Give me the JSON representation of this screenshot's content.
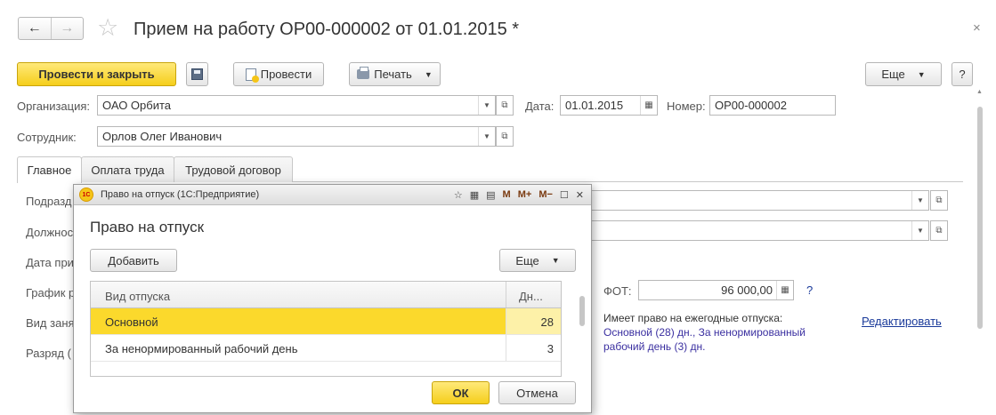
{
  "header": {
    "back_label": "←",
    "forward_label": "→",
    "star_glyph": "☆",
    "title": "Прием на работу ОР00-000002 от 01.01.2015 *",
    "close_glyph": "×"
  },
  "toolbar": {
    "post_close_label": "Провести и закрыть",
    "post_label": "Провести",
    "print_label": "Печать",
    "more_label": "Еще",
    "help_label": "?"
  },
  "form": {
    "org_label": "Организация:",
    "org_value": "ОАО Орбита",
    "date_label": "Дата:",
    "date_value": "01.01.2015",
    "number_label": "Номер:",
    "number_value": "ОР00-000002",
    "employee_label": "Сотрудник:",
    "employee_value": "Орлов Олег Иванович"
  },
  "tabs": [
    {
      "label": "Главное",
      "active": true
    },
    {
      "label": "Оплата труда",
      "active": false
    },
    {
      "label": "Трудовой договор",
      "active": false
    }
  ],
  "main_tab": {
    "labels": [
      "Подразд",
      "Должнос",
      "Дата при",
      "График р",
      "Вид заня",
      "Разряд ("
    ],
    "fot_label": "ФОТ:",
    "fot_value": "96 000,00",
    "fot_help": "?",
    "vacation_heading": "Имеет право на ежегодные отпуска:",
    "vacation_line1": "Основной (28) дн., За ненормированный",
    "vacation_line2": "рабочий день (3) дн.",
    "edit_link": "Редактировать"
  },
  "modal": {
    "window_title": "Право на отпуск  (1С:Предприятие)",
    "logo_text": "1С",
    "tools": [
      "M",
      "M+",
      "M−"
    ],
    "heading": "Право на отпуск",
    "add_label": "Добавить",
    "more_label": "Еще",
    "columns": [
      "Вид отпуска",
      "Дн..."
    ],
    "rows": [
      {
        "kind": "Основной",
        "days": "28",
        "selected": true
      },
      {
        "kind": "За ненормированный рабочий день",
        "days": "3",
        "selected": false
      }
    ],
    "ok_label": "ОК",
    "cancel_label": "Отмена"
  },
  "colors": {
    "accent_yellow": "#f5ce1b",
    "selected_row": "#fbd92c",
    "link_blue": "#1a3a9a"
  }
}
